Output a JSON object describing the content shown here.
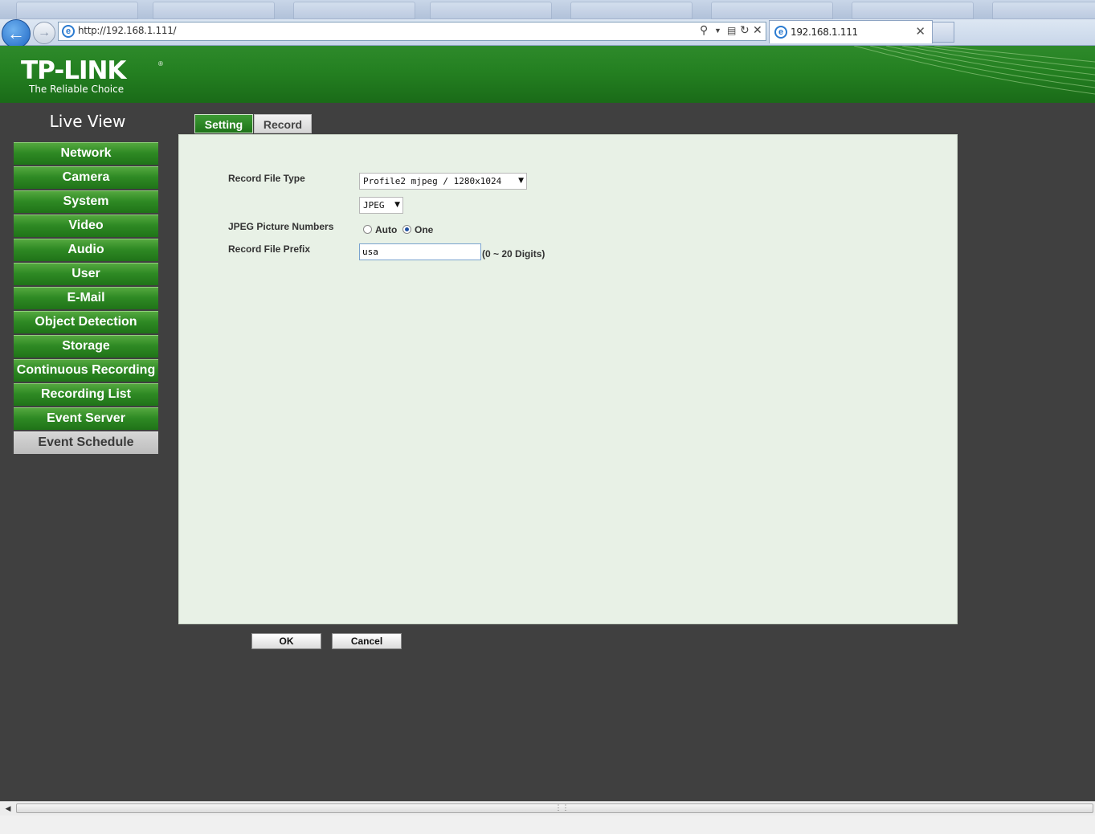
{
  "browser": {
    "url": "http://192.168.1.111/",
    "tab_title": "192.168.1.111"
  },
  "brand": {
    "logo": "TP-LINK",
    "tagline": "The Reliable Choice",
    "header_green": "#248021"
  },
  "sidebar": {
    "title": "Live View",
    "items": [
      {
        "label": "Network",
        "selected": false
      },
      {
        "label": "Camera",
        "selected": false
      },
      {
        "label": "System",
        "selected": false
      },
      {
        "label": "Video",
        "selected": false
      },
      {
        "label": "Audio",
        "selected": false
      },
      {
        "label": "User",
        "selected": false
      },
      {
        "label": "E-Mail",
        "selected": false
      },
      {
        "label": "Object Detection",
        "selected": false
      },
      {
        "label": "Storage",
        "selected": false
      },
      {
        "label": "Continuous Recording",
        "selected": false
      },
      {
        "label": "Recording List",
        "selected": false
      },
      {
        "label": "Event Server",
        "selected": false
      },
      {
        "label": "Event Schedule",
        "selected": true
      }
    ]
  },
  "tabs": {
    "setting": "Setting",
    "record": "Record",
    "active": "Setting"
  },
  "form": {
    "record_file_type_label": "Record File Type",
    "record_file_type_value": "Profile2 mjpeg / 1280x1024",
    "format_value": "JPEG",
    "jpeg_numbers_label": "JPEG Picture Numbers",
    "jpeg_options": {
      "auto": "Auto",
      "one": "One"
    },
    "jpeg_selected": "One",
    "prefix_label": "Record File Prefix",
    "prefix_value": "usa",
    "prefix_hint": "(0 ~ 20 Digits)"
  },
  "buttons": {
    "ok": "OK",
    "cancel": "Cancel"
  }
}
